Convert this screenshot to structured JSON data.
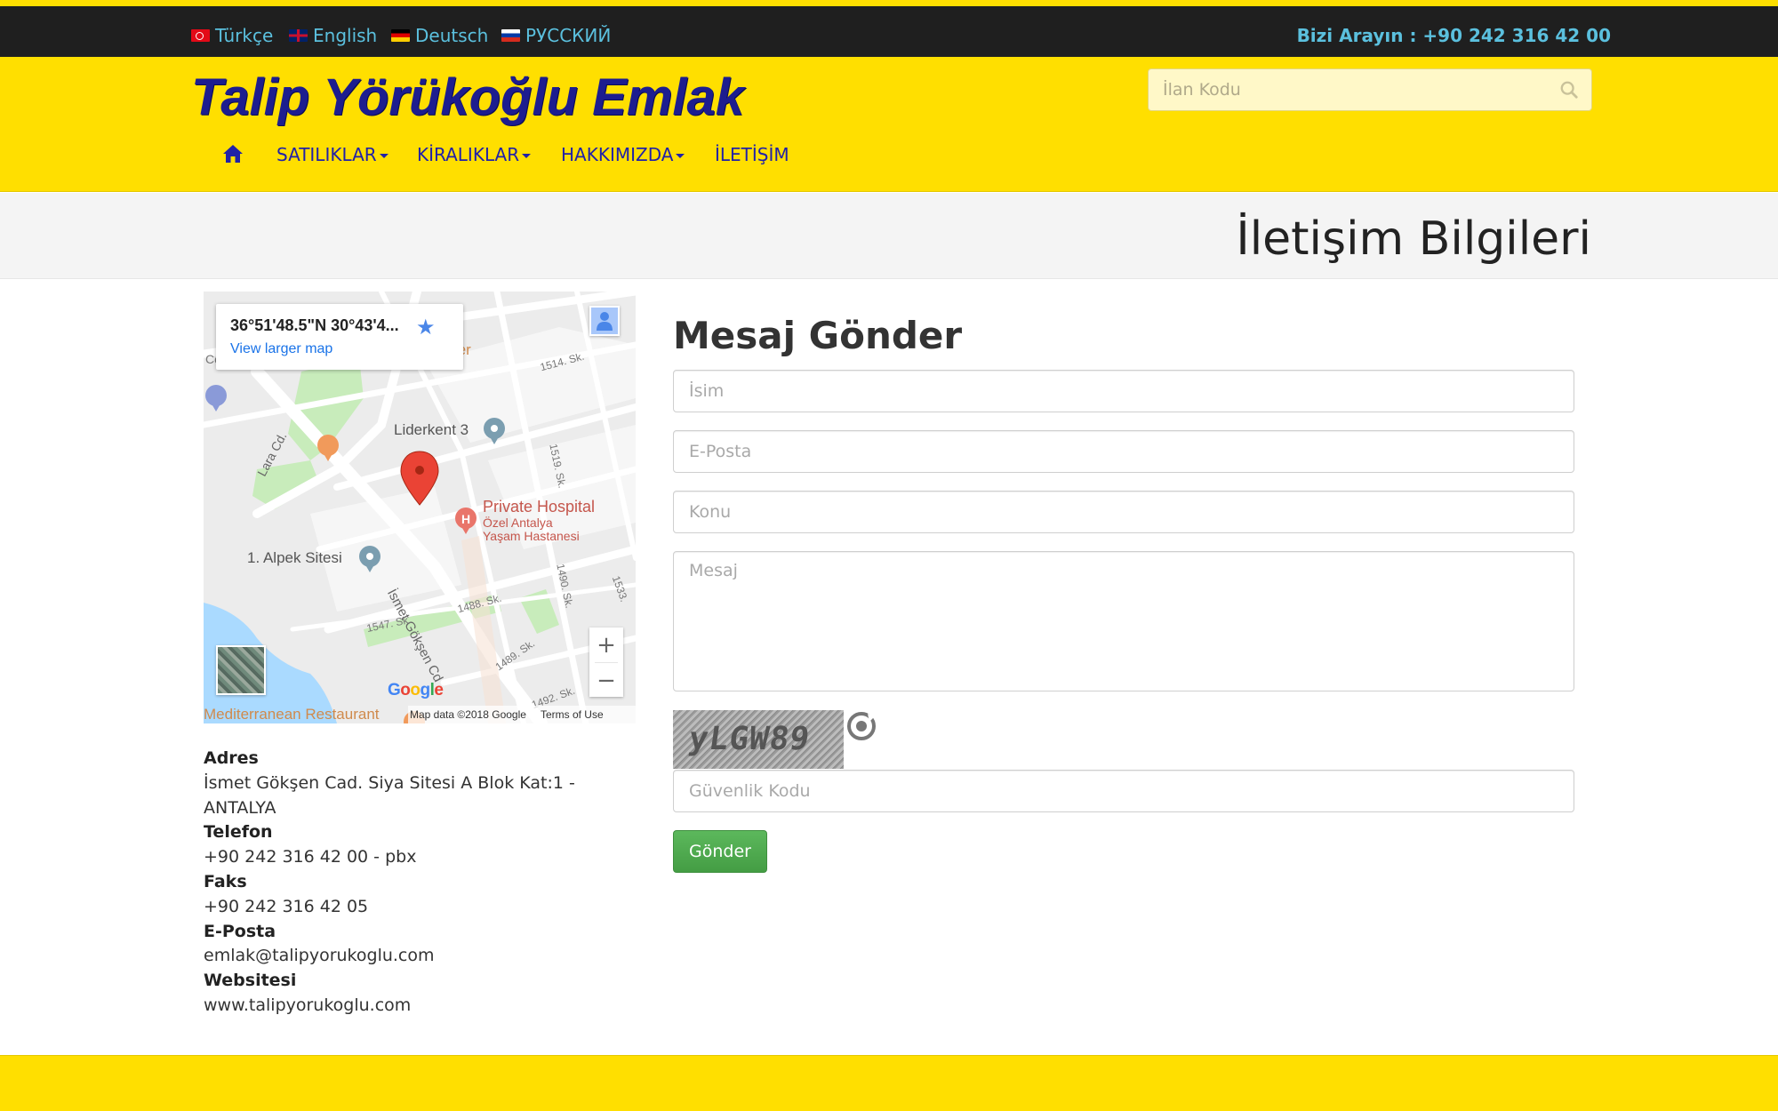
{
  "topbar": {
    "languages": [
      {
        "label": "Türkçe",
        "flag": "flag-tr-icon"
      },
      {
        "label": "English",
        "flag": "flag-gb-icon"
      },
      {
        "label": "Deutsch",
        "flag": "flag-de-icon"
      },
      {
        "label": "РУССКИЙ",
        "flag": "flag-ru-icon"
      }
    ],
    "call_us": "Bizi Arayın : +90 242 316 42 00"
  },
  "header": {
    "logo_text": "Talip Yörükoğlu Emlak",
    "search_placeholder": "İlan Kodu"
  },
  "nav": {
    "home_icon": "home-icon",
    "items": [
      {
        "label": "SATILIKLAR",
        "dropdown": true
      },
      {
        "label": "KİRALIKLAR",
        "dropdown": true
      },
      {
        "label": "HAKKIMIZDA",
        "dropdown": true
      },
      {
        "label": "İLETİŞİM",
        "dropdown": false
      }
    ]
  },
  "page": {
    "title": "İletişim Bilgileri"
  },
  "map": {
    "coords": "36°51'48.5\"N 30°43'4...",
    "larger_map": "View larger map",
    "labels": {
      "liderkent": "Liderkent 3",
      "hospital": "Private Hospital",
      "hospital_sub1": "Özel Antalya",
      "hospital_sub2": "Yaşam Hastanesi",
      "alpek": "1. Alpek Sitesi",
      "lara": "Lara Cd.",
      "ismet": "İsmet Gökşen Cd",
      "s1514": "1514. Sk.",
      "s1519": "1519. Sk.",
      "s1488": "1488. Sk.",
      "s1547": "1547. Sk.",
      "s1489": "1489. Sk.",
      "s1490": "1490. Sk.",
      "s1492": "1492. Sk.",
      "s1533": "1533.",
      "restaurant": "Mediterranean Restaurant",
      "ter": "ter",
      "co": "Co"
    },
    "google": "Google",
    "map_data": "Map data ©2018 Google",
    "terms": "Terms of Use",
    "zoom_in": "+",
    "zoom_out": "−"
  },
  "contact": {
    "address_label": "Adres",
    "address_value": "İsmet Gökşen Cad. Siya Sitesi A Blok Kat:1 - ANTALYA",
    "phone_label": "Telefon",
    "phone_value": "+90 242 316 42 00 - pbx",
    "fax_label": "Faks",
    "fax_value": "+90 242 316 42 05",
    "email_label": "E-Posta",
    "email_value": "emlak@talipyorukoglu.com",
    "website_label": "Websitesi",
    "website_value": "www.talipyorukoglu.com"
  },
  "form": {
    "title": "Mesaj Gönder",
    "name_placeholder": "İsim",
    "email_placeholder": "E-Posta",
    "subject_placeholder": "Konu",
    "message_placeholder": "Mesaj",
    "captcha_text": "yLGW89",
    "security_placeholder": "Güvenlik Kodu",
    "submit_label": "Gönder"
  },
  "colors": {
    "brand_yellow": "#ffdf00",
    "topbar_dark": "#1f1f1f",
    "link_blue": "#5bc0de",
    "nav_blue": "#2121a8",
    "logo_navy": "#1d1d8f",
    "submit_green": "#5cb85c"
  }
}
